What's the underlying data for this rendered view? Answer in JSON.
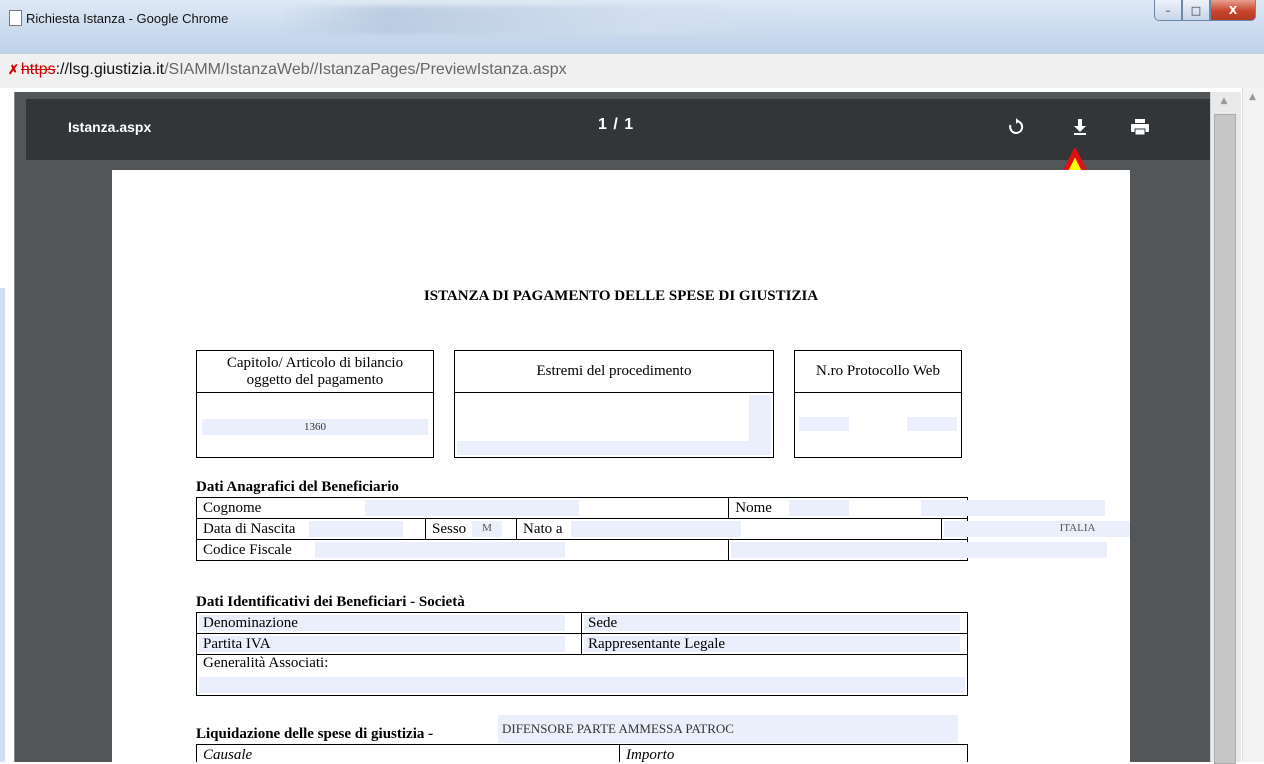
{
  "window": {
    "title": "Richiesta Istanza - Google Chrome",
    "controls": {
      "minimize": "–",
      "maximize": "□",
      "close": "X"
    }
  },
  "address": {
    "scheme": "https",
    "rest_host": "://lsg.giustizia.it",
    "path": "/SIAMM/IstanzaWeb//IstanzaPages/PreviewIstanza.aspx"
  },
  "viewer": {
    "file_name": "Istanza.aspx",
    "page_indicator": "1 / 1",
    "icons": [
      "rotate-icon",
      "download-icon",
      "print-icon"
    ],
    "highlight_arrow_color": "#ffff00",
    "highlight_arrow_border": "#e01010"
  },
  "document": {
    "title": "ISTANZA DI PAGAMENTO DELLE SPESE DI GIUSTIZIA",
    "box1": {
      "header_line1": "Capitolo/ Articolo di bilancio",
      "header_line2": "oggetto del pagamento",
      "value": "1360"
    },
    "box2": {
      "header": "Estremi del procedimento"
    },
    "box3": {
      "header": "N.ro Protocollo Web"
    },
    "anagrafici": {
      "title": "Dati Anagrafici del Beneficiario",
      "cognome": "Cognome",
      "nome": "Nome",
      "data_nascita": "Data di Nascita",
      "sesso": "Sesso",
      "sesso_value": "M",
      "nato_a": "Nato a",
      "paese": "ITALIA",
      "codice_fiscale": "Codice Fiscale"
    },
    "societa": {
      "title": "Dati Identificativi dei Beneficiari - Società",
      "denominazione": "Denominazione",
      "sede": "Sede",
      "partita_iva": "Partita IVA",
      "rappresentante": "Rappresentante Legale",
      "generalita": "Generalità Associati:"
    },
    "liquidazione": {
      "title": "Liquidazione delle spese di giustizia -",
      "tipo": "DIFENSORE PARTE AMMESSA PATROC",
      "causale": "Causale",
      "importo": "Importo"
    }
  }
}
